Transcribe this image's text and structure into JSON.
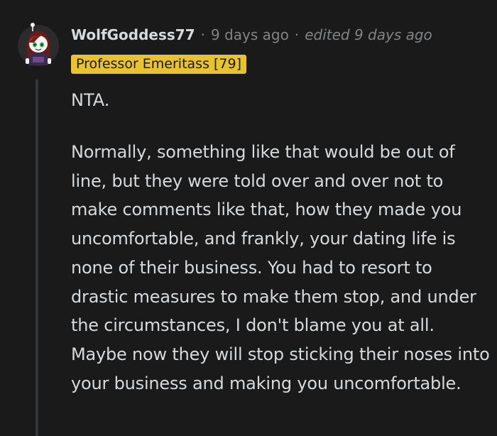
{
  "comment": {
    "author": "WolfGoddess77",
    "separator": "·",
    "posted": "9 days ago",
    "edited": "edited 9 days ago",
    "flair": "Professor Emeritass [79]",
    "avatar_icon": "snoo-avatar-icon",
    "paragraphs": [
      "NTA.",
      "Normally, something like that would be out of line, but they were told over and over not to make comments like that, how they made you uncomfortable, and frankly, your dating life is none of their business. You had to resort to drastic measures to make them stop, and under the circumstances, I don't blame you at all. Maybe now they will stop sticking their noses into your business and making you uncomfortable."
    ]
  },
  "colors": {
    "background": "#1a1a1b",
    "text": "#d7dadc",
    "meta": "#818384",
    "flair_bg": "#e9c233",
    "flair_text": "#1a1a1b",
    "thread_line": "#343536"
  }
}
